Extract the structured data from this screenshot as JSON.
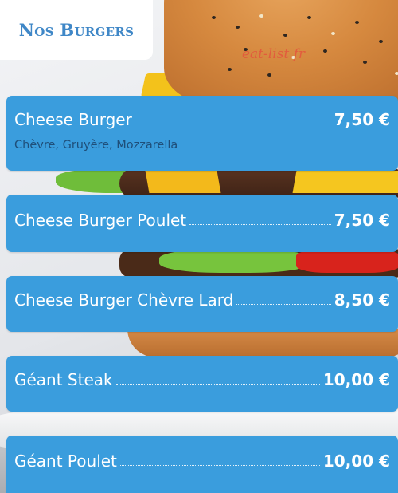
{
  "header": {
    "title": "Nos Burgers",
    "watermark": "eat-list.fr"
  },
  "colors": {
    "card": "#3a9ddd",
    "title": "#3f87c7",
    "desc": "#1f4f7a",
    "watermark": "#e64c3c"
  },
  "menu": {
    "items": [
      {
        "name": "Cheese Burger",
        "price": "7,50 €",
        "description": "Chèvre, Gruyère, Mozzarella"
      },
      {
        "name": "Cheese Burger Poulet",
        "price": "7,50 €"
      },
      {
        "name": "Cheese Burger Chèvre Lard",
        "price": "8,50 €"
      },
      {
        "name": "Géant Steak",
        "price": "10,00 €"
      },
      {
        "name": "Géant Poulet",
        "price": "10,00 €"
      }
    ]
  }
}
